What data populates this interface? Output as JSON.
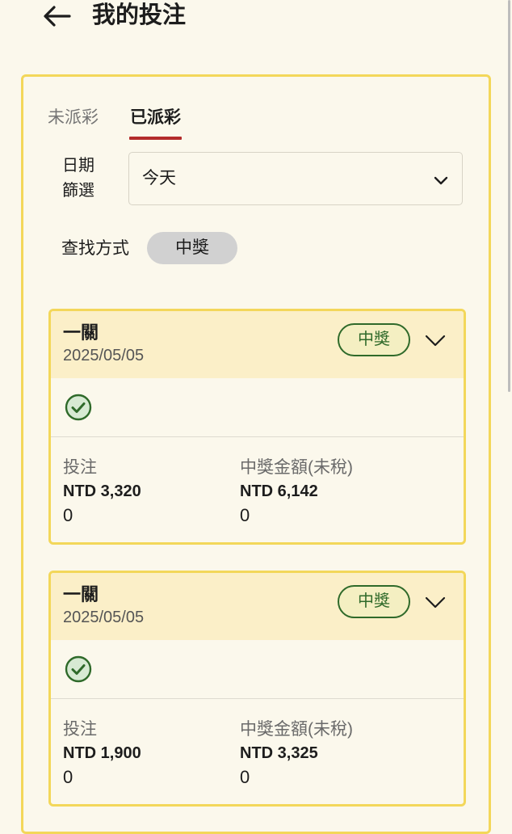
{
  "header": {
    "title": "我的投注",
    "back_icon": "arrow-left-icon"
  },
  "tabs": [
    {
      "label": "未派彩",
      "active": false
    },
    {
      "label": "已派彩",
      "active": true
    }
  ],
  "filter": {
    "date_label": "日期\n篩選",
    "date_value": "今天",
    "search_label": "查找方式",
    "search_chip": "中獎"
  },
  "bets": [
    {
      "title": "一關",
      "date": "2025/05/05",
      "status": "中獎",
      "stake_label": "投注",
      "stake_amount": "NTD 3,320",
      "stake_extra": "0",
      "win_label": "中獎金額(未稅)",
      "win_amount": "NTD 6,142",
      "win_extra": "0"
    },
    {
      "title": "一關",
      "date": "2025/05/05",
      "status": "中獎",
      "stake_label": "投注",
      "stake_amount": "NTD 1,900",
      "stake_extra": "0",
      "win_label": "中獎金額(未稅)",
      "win_amount": "NTD 3,325",
      "win_extra": "0"
    }
  ],
  "colors": {
    "background": "#fbf8ec",
    "accent_border": "#f3d75a",
    "tab_underline": "#b32b2b",
    "won_green": "#2f6a2a"
  }
}
